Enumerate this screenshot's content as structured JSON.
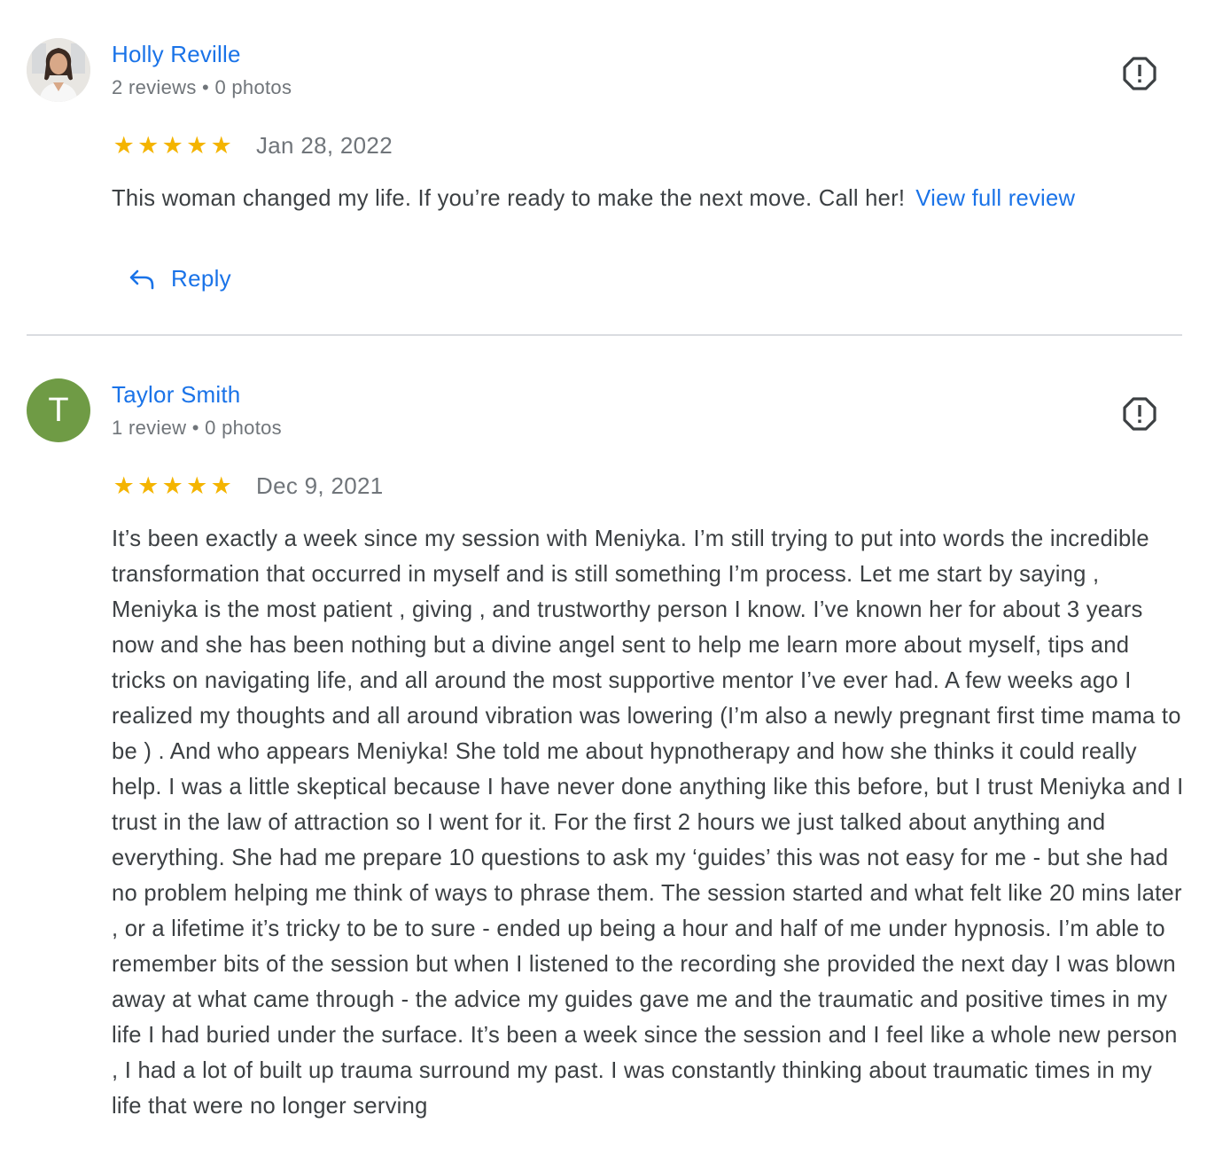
{
  "reviews": [
    {
      "author": "Holly Reville",
      "meta": "2 reviews • 0 photos",
      "rating": 5,
      "date": "Jan 28, 2022",
      "text": "This woman changed my life. If you’re ready to make the next move. Call her!",
      "more_label": "View full review",
      "reply_label": "Reply",
      "avatar": "photo"
    },
    {
      "author": "Taylor Smith",
      "meta": "1 review • 0 photos",
      "rating": 5,
      "date": "Dec 9, 2021",
      "avatar_letter": "T",
      "text": "It’s been exactly a week since my session with Meniyka. I’m still trying to put into words the incredible transformation that occurred in myself and is still something I’m process. Let me start by saying , Meniyka is the most patient , giving , and trustworthy person I know. I’ve known her for about 3 years now and she has been nothing but a divine angel sent to help me learn more about myself, tips and tricks on navigating life, and all around the most supportive mentor I’ve ever had. A few weeks ago I realized my thoughts and all around vibration was lowering (I’m also a newly pregnant first time mama to be ) . And who appears Meniyka! She told me about hypnotherapy and how she thinks it could really help. I was a little skeptical because I have never done anything like this before, but I trust Meniyka and I trust in the law of attraction so I went for it. For the first 2 hours we just talked about anything and everything. She had me prepare 10 questions to ask my ‘guides’ this was not easy for me - but she had no problem helping me think of ways to phrase them. The session started and what felt like 20 mins later , or a lifetime it’s tricky to be to sure - ended up being a hour and half of me under hypnosis. I’m able to remember bits of the session but when I listened to the recording she provided the next day I was blown away at what came through - the advice my guides gave me and the traumatic and positive times in my life I had buried under the surface. It’s been a week since the session and I feel like a whole new person , I had a lot of built up trauma surround my past. I was constantly thinking about traumatic times in my life that were no longer serving"
    }
  ],
  "icons": {
    "report": "report-flag-icon",
    "reply": "reply-arrow-icon",
    "star": "star-icon"
  },
  "colors": {
    "link": "#1a73e8",
    "star": "#f4b400",
    "avatar_bg": "#6f9b45"
  }
}
